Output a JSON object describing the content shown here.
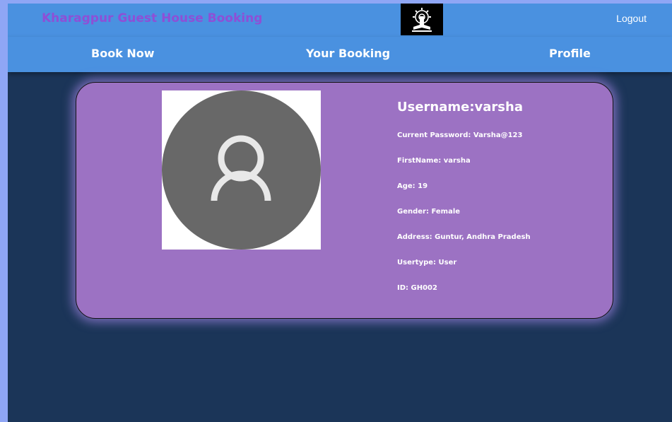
{
  "header": {
    "brand": "Kharagpur Guest House Booking",
    "logout_label": "Logout",
    "logo_icon": "iit-kharagpur-emblem-icon"
  },
  "nav": {
    "book_now": "Book Now",
    "your_booking": "Your Booking",
    "profile": "Profile"
  },
  "profile": {
    "avatar_icon": "user-avatar-icon",
    "username": "Username:varsha",
    "current_password": "Current Password: Varsha@123",
    "first_name": "FirstName: varsha",
    "age": "Age: 19",
    "gender": "Gender: Female",
    "address": "Address: Guntur, Andhra Pradesh",
    "usertype": "Usertype: User",
    "id": "ID: GH002"
  },
  "colors": {
    "page_bg": "#1b3558",
    "bar_bg": "#4a91e0",
    "brand_text": "#8e4fd6",
    "card_bg": "#9c72c3",
    "avatar_circle": "#686868"
  }
}
